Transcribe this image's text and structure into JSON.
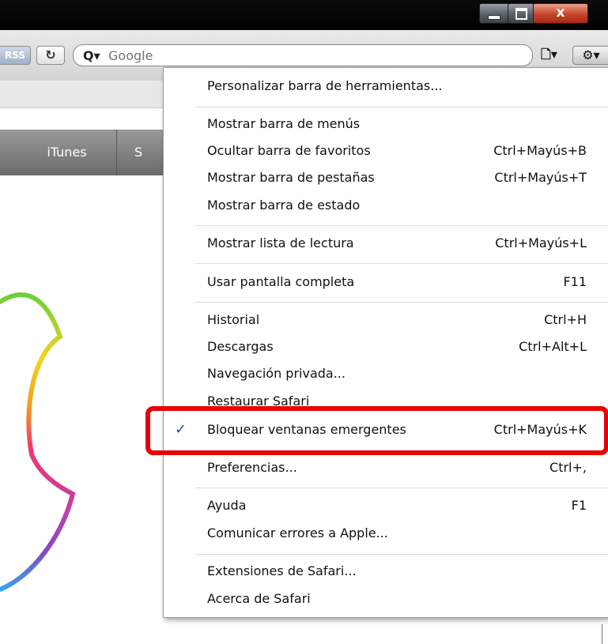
{
  "toolbar": {
    "rss_label": "RSS",
    "reload_icon": "reload-icon",
    "search_placeholder": "Google",
    "page_icon": "page-menu-icon",
    "gear_icon": "gear-icon"
  },
  "nav": {
    "items": [
      "iTunes",
      "S"
    ]
  },
  "menu": {
    "items": [
      {
        "label": "Personalizar barra de herramientas...",
        "shortcut": ""
      },
      {
        "label": "Mostrar barra de menús",
        "shortcut": ""
      },
      {
        "label": "Ocultar barra de favoritos",
        "shortcut": "Ctrl+Mayús+B"
      },
      {
        "label": "Mostrar barra de pestañas",
        "shortcut": "Ctrl+Mayús+T"
      },
      {
        "label": "Mostrar barra de estado",
        "shortcut": ""
      },
      {
        "label": "Mostrar lista de lectura",
        "shortcut": "Ctrl+Mayús+L"
      },
      {
        "label": "Usar pantalla completa",
        "shortcut": "F11"
      },
      {
        "label": "Historial",
        "shortcut": "Ctrl+H"
      },
      {
        "label": "Descargas",
        "shortcut": "Ctrl+Alt+L"
      },
      {
        "label": "Navegación privada...",
        "shortcut": ""
      },
      {
        "label": "Restaurar Safari",
        "shortcut": ""
      },
      {
        "label": "Bloquear ventanas emergentes",
        "shortcut": "Ctrl+Mayús+K",
        "checked": true
      },
      {
        "label": "Preferencias...",
        "shortcut": "Ctrl+,"
      },
      {
        "label": "Ayuda",
        "shortcut": "F1"
      },
      {
        "label": "Comunicar errores a Apple...",
        "shortcut": ""
      },
      {
        "label": "Extensiones de Safari...",
        "shortcut": ""
      },
      {
        "label": "Acerca de Safari",
        "shortcut": ""
      }
    ],
    "check_mark": "✓"
  },
  "window": {
    "close_glyph": "x"
  },
  "colors": {
    "highlight": "#e60000",
    "check": "#1f4aa8"
  }
}
